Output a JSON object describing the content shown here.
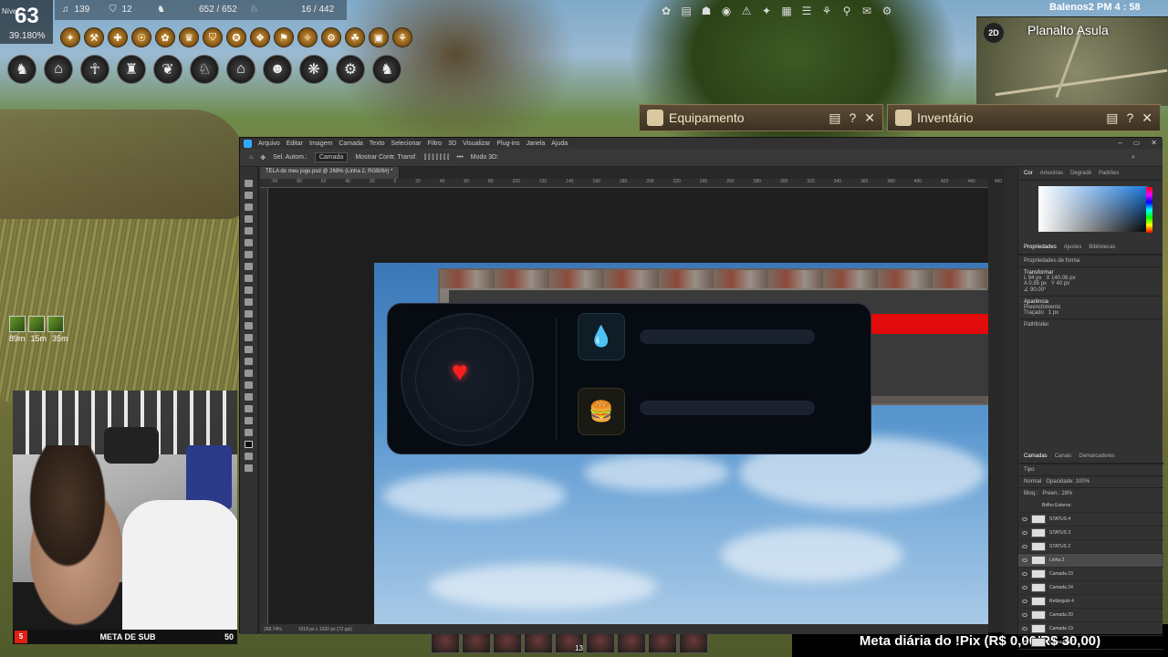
{
  "hud": {
    "level_label": "Nível",
    "level": "63",
    "xp_pct": "39.180%",
    "stat1": "139",
    "stat2": "12",
    "hp": "652 / 652",
    "mp": "16 / 442",
    "player": "Balenos2",
    "clock": "PM 4 : 58",
    "minimap_mode": "2D",
    "region": "Planalto Asula",
    "buff_times": [
      "89m",
      "15m",
      "35m"
    ]
  },
  "panels": {
    "equip_title": "Equipamento",
    "inv_title": "Inventário"
  },
  "webcam": {
    "badge": "5",
    "meta_label": "META DE SUB",
    "meta_count": "50"
  },
  "pix_goal": "Meta diária do !Pix (R$ 0,00/R$ 30,00)",
  "skillbar": {
    "slot_count": "13"
  },
  "photoshop": {
    "menu": [
      "Arquivo",
      "Editar",
      "Imagem",
      "Camada",
      "Texto",
      "Selecionar",
      "Filtro",
      "3D",
      "Visualizar",
      "Plug-ins",
      "Janela",
      "Ajuda"
    ],
    "options": {
      "auto_select": "Sel. Autom.:",
      "layer_mode": "Camada",
      "show_transform": "Mostrar Contr. Transf.",
      "mode3d": "Modo 3D:"
    },
    "doc_tab": "TELA do meu jogo.psd @ 269% (Linha 2, RGB/8#) *",
    "ruler": [
      "-90",
      "80",
      "60",
      "40",
      "20",
      "0",
      "20",
      "40",
      "60",
      "80",
      "100",
      "120",
      "140",
      "160",
      "180",
      "200",
      "220",
      "240",
      "260",
      "280",
      "300",
      "320",
      "340",
      "360",
      "380",
      "400",
      "420",
      "440",
      "460"
    ],
    "status_zoom": "268.74%",
    "status_size": "1918 px x 1032 px (72 ppi)",
    "color_tabs": [
      "Cor",
      "Amostras",
      "Degradê",
      "Padrões"
    ],
    "props_tabs": [
      "Propriedades",
      "Ajustes",
      "Bibliotecas"
    ],
    "props_shape": "Propriedades de forma",
    "transform_label": "Transformar",
    "t_w": "94 px",
    "t_x": "140.06 px",
    "t_h": "0.85 px",
    "t_y": "40 px",
    "t_angle": "90.00°",
    "appearance": "Aparência",
    "fill": "Preenchimento",
    "stroke": "Traçado",
    "stroke_w": "1 px",
    "pathfinder": "Pathfinder",
    "layers_tabs": [
      "Camadas",
      "Canais",
      "Demarcadores"
    ],
    "kind": "Tipo",
    "blend": "Normal",
    "opacity": "Opacidade: 100%",
    "lock": "Bloq.:",
    "fill_pct": "Preen.: 28%",
    "effect": "Brilho Externo",
    "layers": [
      "STATUS 4",
      "STATUS 3",
      "STATUS 2",
      "Linha 2",
      "Camada 23",
      "Camada 24",
      "Retângulo 4",
      "Camada 20",
      "Camada 19",
      "Camada 17"
    ]
  }
}
